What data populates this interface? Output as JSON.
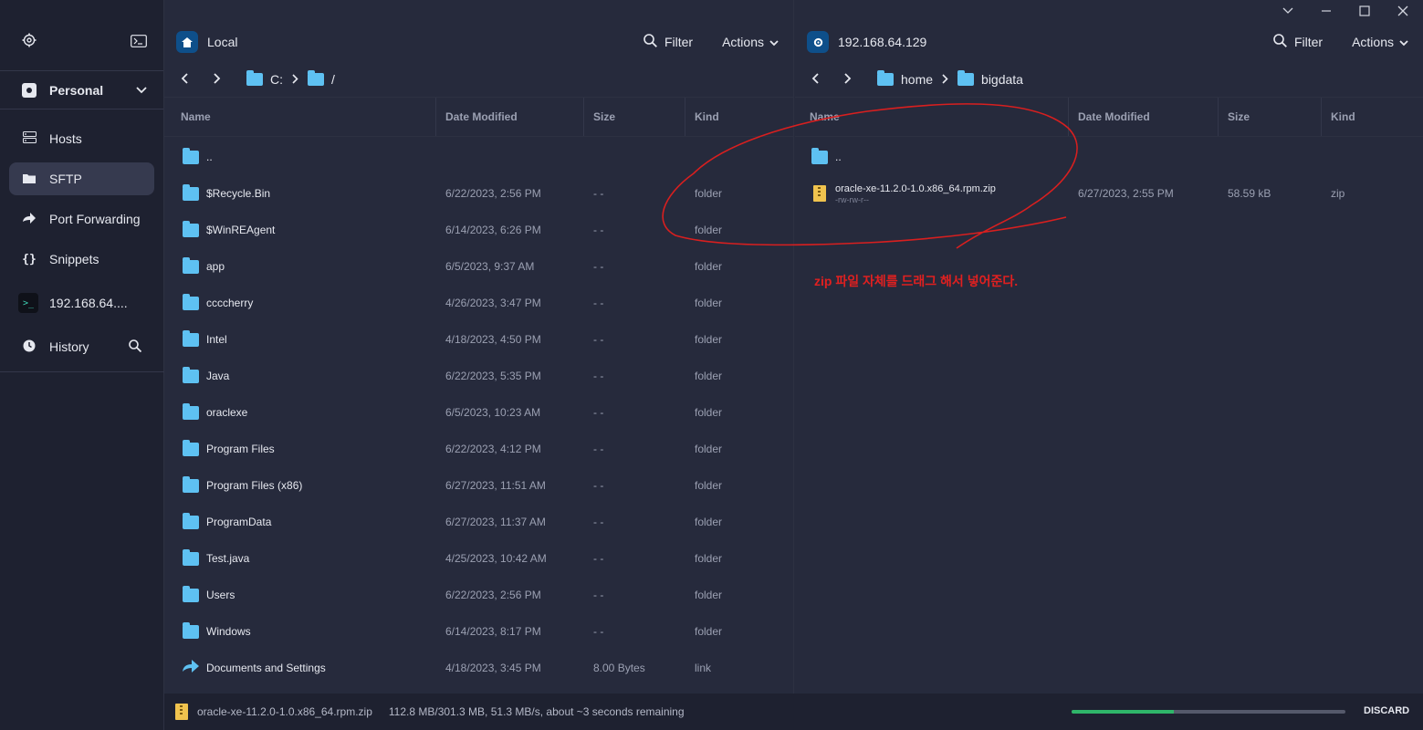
{
  "sidebar": {
    "vault_label": "Personal",
    "items": [
      {
        "label": "Hosts",
        "icon": "hosts-icon"
      },
      {
        "label": "SFTP",
        "icon": "folder-icon"
      },
      {
        "label": "Port Forwarding",
        "icon": "port-forward-icon"
      },
      {
        "label": "Snippets",
        "icon": "braces-icon"
      },
      {
        "label": "192.168.64....",
        "icon": "terminal-icon"
      },
      {
        "label": "History",
        "icon": "clock-icon"
      }
    ]
  },
  "left": {
    "title": "Local",
    "filter_label": "Filter",
    "actions_label": "Actions",
    "crumbs": [
      "C:",
      "/"
    ],
    "columns": [
      "Name",
      "Date Modified",
      "Size",
      "Kind"
    ],
    "rows": [
      {
        "name": "..",
        "date": "",
        "size": "",
        "kind": ""
      },
      {
        "name": "$Recycle.Bin",
        "date": "6/22/2023, 2:56 PM",
        "size": "- -",
        "kind": "folder"
      },
      {
        "name": "$WinREAgent",
        "date": "6/14/2023, 6:26 PM",
        "size": "- -",
        "kind": "folder"
      },
      {
        "name": "app",
        "date": "6/5/2023, 9:37 AM",
        "size": "- -",
        "kind": "folder"
      },
      {
        "name": "ccccherry",
        "date": "4/26/2023, 3:47 PM",
        "size": "- -",
        "kind": "folder"
      },
      {
        "name": "Intel",
        "date": "4/18/2023, 4:50 PM",
        "size": "- -",
        "kind": "folder"
      },
      {
        "name": "Java",
        "date": "6/22/2023, 5:35 PM",
        "size": "- -",
        "kind": "folder"
      },
      {
        "name": "oraclexe",
        "date": "6/5/2023, 10:23 AM",
        "size": "- -",
        "kind": "folder"
      },
      {
        "name": "Program Files",
        "date": "6/22/2023, 4:12 PM",
        "size": "- -",
        "kind": "folder"
      },
      {
        "name": "Program Files (x86)",
        "date": "6/27/2023, 11:51 AM",
        "size": "- -",
        "kind": "folder"
      },
      {
        "name": "ProgramData",
        "date": "6/27/2023, 11:37 AM",
        "size": "- -",
        "kind": "folder"
      },
      {
        "name": "Test.java",
        "date": "4/25/2023, 10:42 AM",
        "size": "- -",
        "kind": "folder"
      },
      {
        "name": "Users",
        "date": "6/22/2023, 2:56 PM",
        "size": "- -",
        "kind": "folder"
      },
      {
        "name": "Windows",
        "date": "6/14/2023, 8:17 PM",
        "size": "- -",
        "kind": "folder"
      },
      {
        "name": "Documents and Settings",
        "date": "4/18/2023, 3:45 PM",
        "size": "8.00 Bytes",
        "kind": "link"
      }
    ]
  },
  "right": {
    "title": "192.168.64.129",
    "filter_label": "Filter",
    "actions_label": "Actions",
    "crumbs": [
      "home",
      "bigdata"
    ],
    "columns": [
      "Name",
      "Date Modified",
      "Size",
      "Kind"
    ],
    "parent_row": "..",
    "file": {
      "name": "oracle-xe-11.2.0-1.0.x86_64.rpm.zip",
      "perms": "-rw-rw-r--",
      "date": "6/27/2023, 2:55 PM",
      "size": "58.59 kB",
      "kind": "zip"
    },
    "annotation": "zip 파일 자체를 드래그 해서 넣어준다."
  },
  "status": {
    "file": "oracle-xe-11.2.0-1.0.x86_64.rpm.zip",
    "progress_text": "112.8 MB/301.3 MB, 51.3 MB/s, about ~3 seconds remaining",
    "progress_fraction": 0.374,
    "discard_label": "DISCARD"
  },
  "colors": {
    "accent": "#0e4f8a",
    "folder": "#5ec1f2",
    "progress": "#2fb569",
    "annotation": "#e02020"
  }
}
